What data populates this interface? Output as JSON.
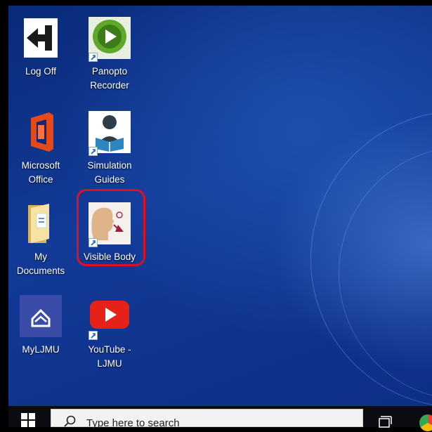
{
  "desktop": {
    "icons": [
      {
        "label": "Log Off",
        "icon": "log-off-icon"
      },
      {
        "label": "Panopto\nRecorder",
        "icon": "panopto-icon"
      },
      {
        "label": "Microsoft\nOffice",
        "icon": "office-icon"
      },
      {
        "label": "Simulation\nGuides",
        "icon": "simulation-guides-icon"
      },
      {
        "label": "My\nDocuments",
        "icon": "folder-icon"
      },
      {
        "label": "Visible Body",
        "icon": "visible-body-icon"
      },
      {
        "label": "MyLJMU",
        "icon": "myljmu-icon"
      },
      {
        "label": "YouTube -\nLJMU",
        "icon": "youtube-icon"
      }
    ],
    "highlight_color": "#e01020"
  },
  "taskbar": {
    "search_placeholder": "Type here to search"
  }
}
